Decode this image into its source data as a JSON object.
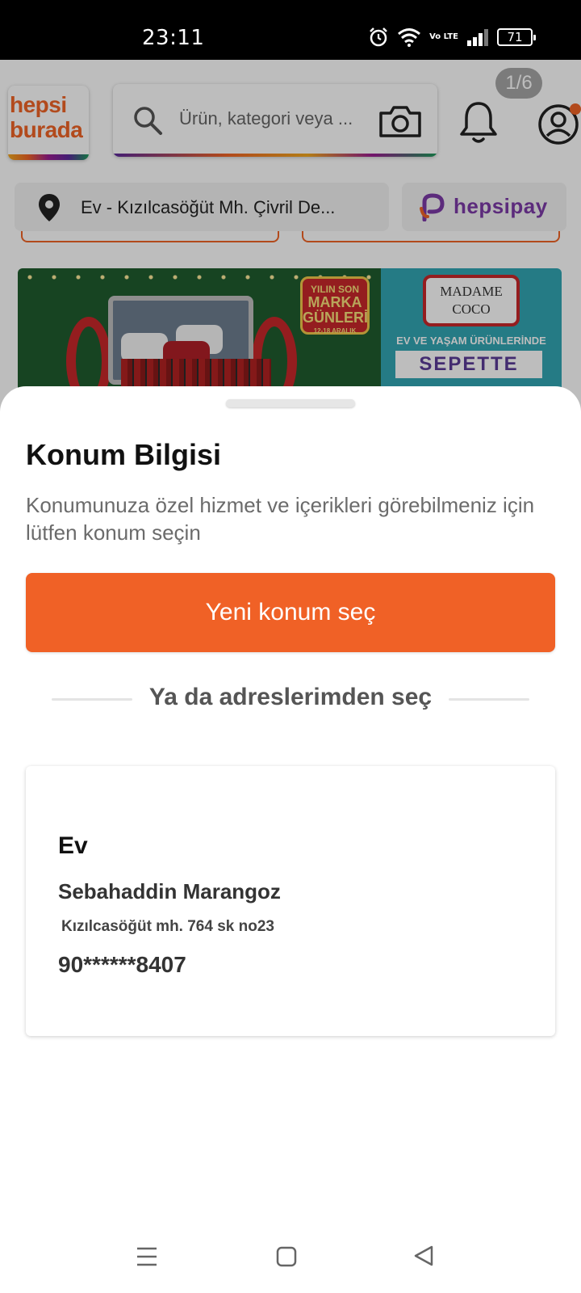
{
  "status_bar": {
    "time": "23:11",
    "network_label": "Vo LTE",
    "battery": "71",
    "icons": [
      "alarm-icon",
      "wifi-icon",
      "volte-icon",
      "signal-icon",
      "battery-icon"
    ]
  },
  "header": {
    "logo_line1": "hepsi",
    "logo_line2": "burada",
    "search_placeholder": "Ürün, kategori veya ...",
    "icons": [
      "search-icon",
      "camera-icon",
      "bell-icon",
      "profile-icon"
    ]
  },
  "location_bar": {
    "text": "Ev - Kızılcasöğüt Mh. Çivril De...",
    "hepsipay_label": "hepsipay"
  },
  "banner": {
    "sale_line1": "YILIN SON",
    "sale_line2": "MARKA",
    "sale_line3": "GÜNLERİ",
    "sale_dates": "12-18 ARALIK",
    "brand_line1": "MADAME",
    "brand_line2": "COCO",
    "subtitle": "EV VE YAŞAM ÜRÜNLERİNDE",
    "cta": "SEPETTE",
    "pager": "1/6"
  },
  "sheet": {
    "title": "Konum Bilgisi",
    "description": "Konumunuza özel hizmet ve içerikleri görebilmeniz için lütfen konum seçin",
    "primary_button": "Yeni konum seç",
    "divider_text": "Ya da adreslerimden seç",
    "address": {
      "title": "Ev",
      "name": "Sebahaddin Marangoz",
      "line": "Kızılcasöğüt mh. 764 sk no23",
      "phone": "90******8407"
    }
  },
  "colors": {
    "brand_orange": "#f06126",
    "hepsipay_purple": "#7c3aa8",
    "status_bar": "#000000"
  },
  "nav_bar": [
    "menu-icon",
    "home-icon",
    "back-icon"
  ]
}
